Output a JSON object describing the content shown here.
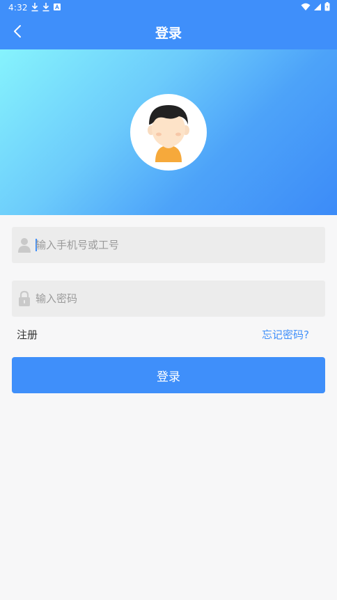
{
  "status_bar": {
    "time": "4:32",
    "icons_left": [
      "download-icon",
      "download-icon",
      "notification-icon"
    ],
    "icons_right": [
      "wifi-icon",
      "signal-icon",
      "battery-icon"
    ]
  },
  "app_bar": {
    "title": "登录",
    "back_icon": "back-arrow-icon",
    "background": "#3f8ffa"
  },
  "hero": {
    "avatar": "user-avatar-illustration",
    "gradient": [
      "#86f3fd",
      "#3c8bf8"
    ]
  },
  "form": {
    "account": {
      "placeholder": "输入手机号或工号",
      "value": "",
      "icon": "person-icon"
    },
    "password": {
      "placeholder": "输入密码",
      "value": "",
      "icon": "lock-icon"
    }
  },
  "links": {
    "register": "注册",
    "forgot_password": "忘记密码?"
  },
  "login_button": {
    "label": "登录"
  },
  "colors": {
    "accent": "#3f8ffa",
    "field_bg": "#ececec",
    "page_bg": "#f7f7f8"
  }
}
